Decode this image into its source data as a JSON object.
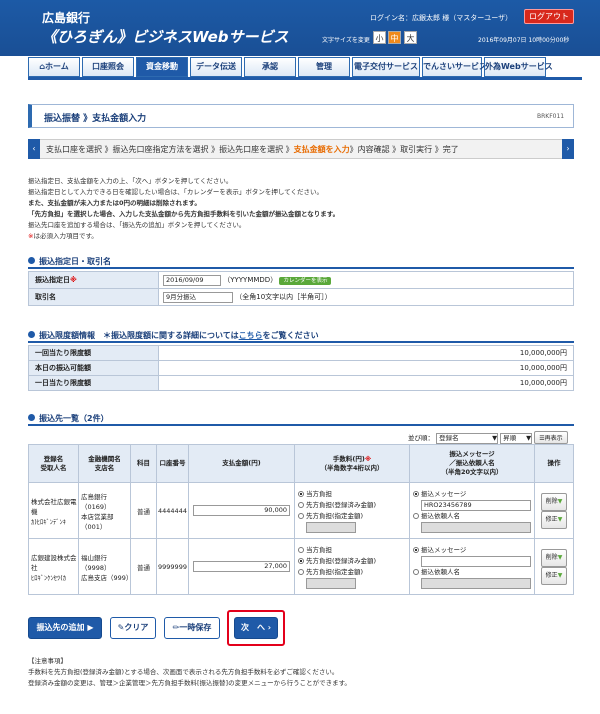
{
  "header": {
    "bank": "広島銀行",
    "service": "《ひろぎん》ビジネスWebサービス",
    "login": "ログイン名：広銀太郎 様（マスターユーザ）",
    "logout": "ログアウト",
    "font_size_label": "文字サイズを変更",
    "fs_small": "小",
    "fs_mid": "中",
    "fs_large": "大",
    "datetime": "2016年09月07日 10時00分00秒"
  },
  "nav": [
    {
      "label": "ホーム",
      "w": 52
    },
    {
      "label": "口座照会",
      "w": 52
    },
    {
      "label": "資金移動",
      "w": 52
    },
    {
      "label": "データ伝送",
      "w": 52
    },
    {
      "label": "承認",
      "w": 52
    },
    {
      "label": "管理",
      "w": 52
    },
    {
      "label": "電子交付サービス",
      "w": 70
    },
    {
      "label": "でんさいサービス",
      "w": 62
    },
    {
      "label": "外為Webサービス",
      "w": 62
    }
  ],
  "page": {
    "title": "振込振替 》支払金額入力",
    "id": "BRKF011"
  },
  "steps": {
    "pre": "支払口座を選択 》振込先口座指定方法を選択 》振込先口座を選択 》",
    "cur": "支払金額を入力",
    "post": "》内容確認 》取引実行 》完了"
  },
  "notes": {
    "n1": "振込指定日、支払金額を入力の上、「次へ」ボタンを押してください。",
    "n2": "振込指定日として入力できる日を確認したい場合は、「カレンダーを表示」ボタンを押してください。",
    "n3": "また、支払金額が未入力または0円の明細は削除されます。",
    "n4": "「先方負担」を選択した場合、入力した支払金額から先方負担手数料を引いた金額が振込金額となります。",
    "n5": "振込先口座を追加する場合は、「振込先の追加」ボタンを押してください。",
    "n6_mark": "※",
    "n6": "は必須入力項目です。"
  },
  "sec1": {
    "title": "振込指定日・取引名",
    "date_label": "振込指定日",
    "req": "※",
    "date_value": "2016/09/09",
    "date_hint": "（YYYYMMDD）",
    "calendar": "カレンダーを表示",
    "name_label": "取引名",
    "name_value": "9月分振込",
    "name_hint": "（全角10文字以内［半角可］）"
  },
  "sec2": {
    "title": "振込限度額情報",
    "note_pre": "＊振込限度額に関する詳細については",
    "note_link": "こちら",
    "note_post": "をご覧ください",
    "r1": "一回当たり限度額",
    "v1": "10,000,000円",
    "r2": "本日の振込可能額",
    "v2": "10,000,000円",
    "r3": "一日当たり限度額",
    "v3": "10,000,000円"
  },
  "sec3": {
    "title": "振込先一覧（2件）",
    "sort_label": "並び順：",
    "sort1": "登録名",
    "sort2": "昇順",
    "redisplay": "再表示",
    "headers": {
      "h1": "登録名\n受取人名",
      "h2": "金融機関名\n支店名",
      "h3": "科目",
      "h4": "口座番号",
      "h5": "支払金額(円)",
      "h6": "手数料(円)",
      "h6b": "（半角数字4桁以内）",
      "h7": "振込メッセージ\n／振込依頼人名\n（半角20文字以内）",
      "h8": "操作"
    },
    "rows": [
      {
        "reg": "株式会社広銀電機",
        "kana": "ｶ)ﾋﾛｷﾞﾝﾃﾞﾝｷ",
        "bank": "広島銀行（0169）",
        "branch": "本店営業部（001）",
        "kind": "普通",
        "acct": "4444444",
        "amount": "90,000",
        "f1": "当方負担",
        "f2": "先方負担(登録済み金額)",
        "f3": "先方負担(指定金額)",
        "msg_label": "振込メッセージ",
        "msg_value": "HRO23456789",
        "req_label": "振込依頼人名",
        "del": "削除",
        "mod": "修正"
      },
      {
        "reg": "広銀建設株式会社",
        "kana": "ﾋﾛｷﾞﾝｹﾝｾﾂ(ｶ",
        "bank": "福山銀行（9998）",
        "branch": "広島支店（999）",
        "kind": "普通",
        "acct": "9999999",
        "amount": "27,000",
        "f1": "当方負担",
        "f2": "先方負担(登録済み金額)",
        "f3": "先方負担(指定金額)",
        "msg_label": "振込メッセージ",
        "msg_value": "",
        "req_label": "振込依頼人名",
        "del": "削除",
        "mod": "修正"
      }
    ]
  },
  "buttons": {
    "add": "振込先の追加",
    "clear": "クリア",
    "save": "一時保存",
    "next": "次　へ"
  },
  "caution": {
    "title": "【注意事項】",
    "c1": "手数料を先方負担(登録済み金額)とする場合、次画面で表示される先方負担手数料を必ずご確認ください。",
    "c2": "登録済み金額の変更は、管理＞企業管理＞先方負担手数料[振込振替]の変更メニューから行うことができます。"
  }
}
